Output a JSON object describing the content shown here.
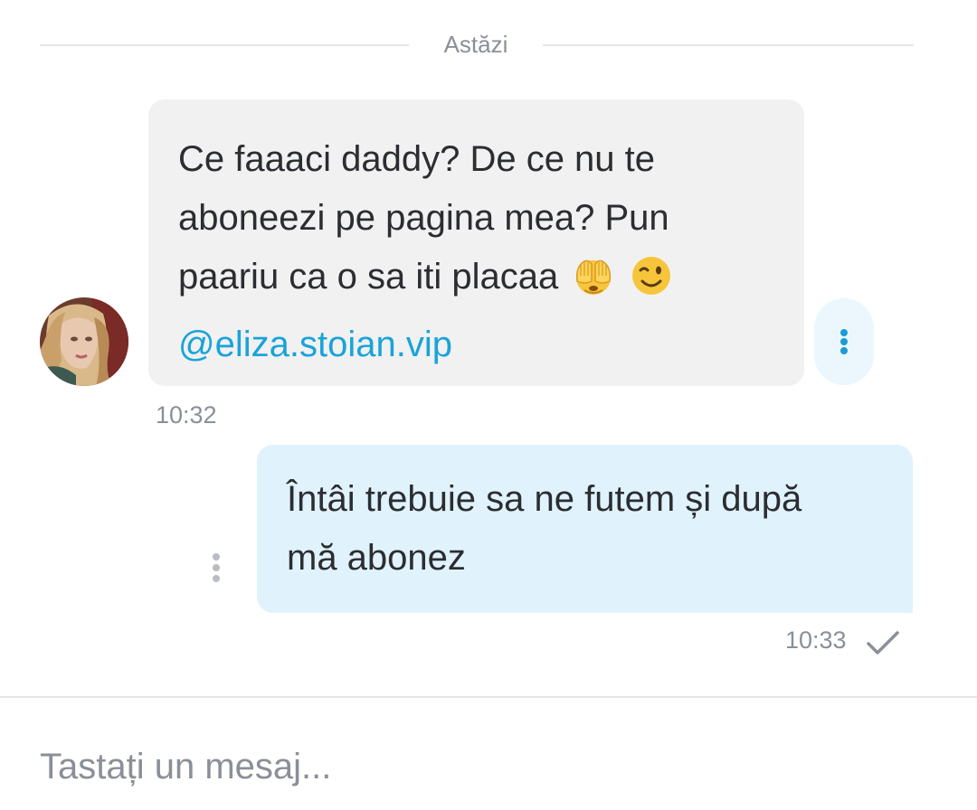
{
  "date_separator": {
    "label": "Astăzi"
  },
  "incoming_message": {
    "lines": [
      "Ce faaaci daddy? De ce nu te",
      "aboneezi pe pagina mea? Pun",
      "paariu ca o sa iti placaa"
    ],
    "emojis": [
      "see-no-evil-monkey-icon",
      "winking-face-icon"
    ],
    "mention": "@eliza.stoian.vip",
    "time": "10:32",
    "avatar": "contact-avatar"
  },
  "outgoing_message": {
    "lines": [
      "Întâi trebuie sa ne futem și după",
      "mă abonez"
    ],
    "time": "10:33",
    "status_icon": "check-icon"
  },
  "composer": {
    "placeholder": "Tastați un mesaj..."
  },
  "colors": {
    "incoming_bubble": "#f1f1f2",
    "outgoing_bubble": "#e0f2fc",
    "link": "#1aa3d8",
    "menu_accent": "#1b9bd7",
    "muted_text": "#8a8f98",
    "body_text": "#2b2d31"
  }
}
